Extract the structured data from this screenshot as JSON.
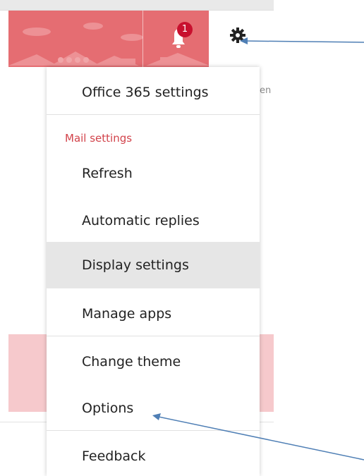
{
  "header": {
    "notification_count": "1",
    "notification_icon": "bell-icon",
    "settings_icon": "gear-icon",
    "background_color": "#e56d72"
  },
  "background": {
    "partial_text": "en"
  },
  "menu": {
    "office_settings_label": "Office 365 settings",
    "section_label": "Mail settings",
    "section_color": "#d2434b",
    "items": [
      {
        "label": "Refresh"
      },
      {
        "label": "Automatic replies"
      },
      {
        "label": "Display settings"
      },
      {
        "label": "Manage apps"
      },
      {
        "label": "Change theme"
      },
      {
        "label": "Options"
      },
      {
        "label": "Feedback"
      }
    ]
  }
}
